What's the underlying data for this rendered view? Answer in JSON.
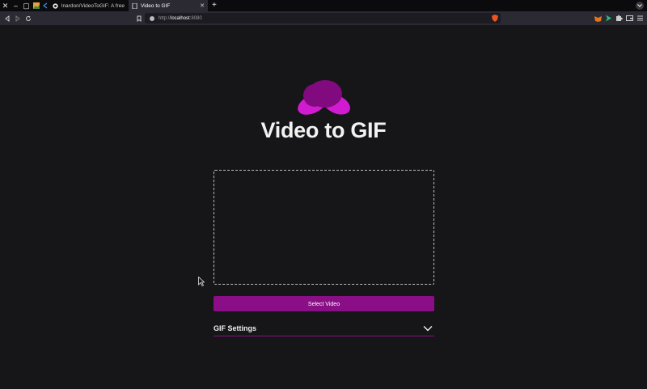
{
  "browser": {
    "tabs": [
      {
        "title": "lnardon/VideoToGIF: A free si",
        "active": false,
        "icon": "github-icon"
      },
      {
        "title": "Video to GIF",
        "active": true,
        "icon": "page-icon"
      }
    ],
    "new_tab_label": "+",
    "url": {
      "prefix": "http://",
      "host": "localhost",
      "port": ":8080"
    }
  },
  "page": {
    "title": "Video to GIF",
    "select_button": "Select Video",
    "settings_label": "GIF Settings"
  },
  "colors": {
    "accent": "#8a0f86",
    "logo_dark": "#820a7f",
    "logo_light": "#d11bd1",
    "background": "#161517"
  }
}
